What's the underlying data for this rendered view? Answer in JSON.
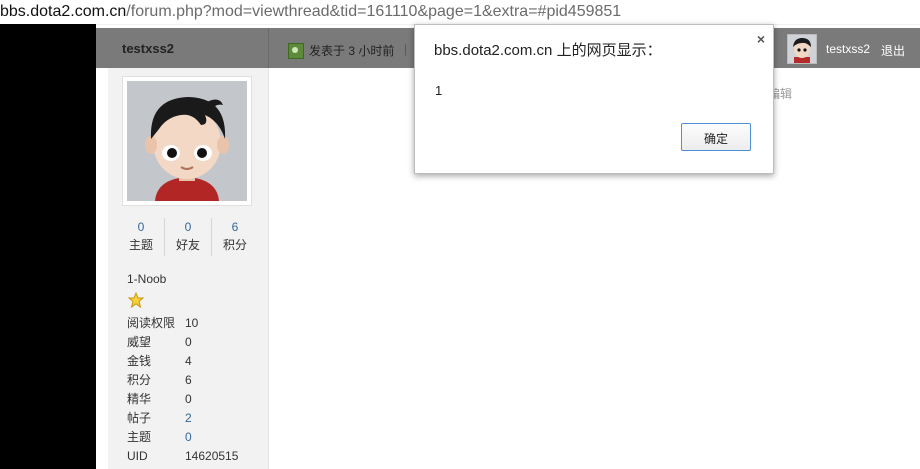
{
  "address_bar": {
    "host": "bbs.dota2.com.cn",
    "path": "/forum.php?mod=viewthread&tid=161110&page=1&extra=#pid459851"
  },
  "header": {
    "author": "testxss2",
    "post_time": "发表于 3 小时前",
    "separator": "|",
    "current_user": "testxss2",
    "logout": "退出"
  },
  "profile": {
    "stats": [
      {
        "value": "0",
        "label": "主题"
      },
      {
        "value": "0",
        "label": "好友"
      },
      {
        "value": "6",
        "label": "积分"
      }
    ],
    "rank": "1-Noob",
    "details": [
      {
        "key": "阅读权限",
        "value": "10"
      },
      {
        "key": "威望",
        "value": "0"
      },
      {
        "key": "金钱",
        "value": "4"
      },
      {
        "key": "积分",
        "value": "6"
      },
      {
        "key": "精华",
        "value": "0"
      },
      {
        "key": "帖子",
        "value": "2"
      },
      {
        "key": "主题",
        "value": "0"
      },
      {
        "key": "UID",
        "value": "14620515"
      }
    ]
  },
  "edit_hint": "编辑",
  "dialog": {
    "title": "bbs.dota2.com.cn 上的网页显示：",
    "message": "1",
    "ok_label": "确定",
    "close_symbol": "×"
  },
  "colors": {
    "link": "#336699",
    "header_dimmed": "#7a7a7a",
    "dialog_button_border": "#4d90d8"
  }
}
